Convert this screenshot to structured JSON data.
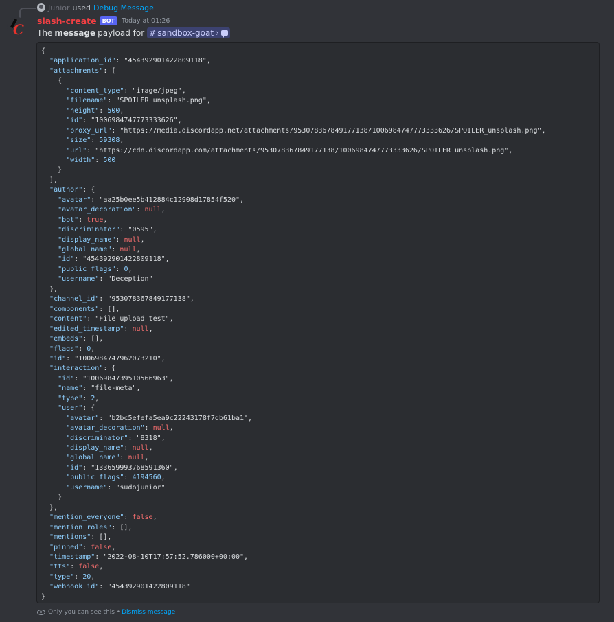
{
  "reply": {
    "user": "Junior",
    "used": "used",
    "command": "Debug Message"
  },
  "message": {
    "author": "slash-create",
    "badge": "BOT",
    "timestamp": "Today at 01:26",
    "intro_the": "The",
    "intro_bold": "message",
    "intro_rest": "payload for",
    "channel_hash": "#",
    "channel": "sandbox-goat",
    "channel_caret": "›"
  },
  "code": {
    "lines": [
      [
        [
          "p",
          "{"
        ]
      ],
      [
        [
          "p",
          "  "
        ],
        [
          "k",
          "\"application_id\""
        ],
        [
          "p",
          ": "
        ],
        [
          "s",
          "\"454392901422809118\""
        ],
        [
          "p",
          ","
        ]
      ],
      [
        [
          "p",
          "  "
        ],
        [
          "k",
          "\"attachments\""
        ],
        [
          "p",
          ": ["
        ]
      ],
      [
        [
          "p",
          "    {"
        ]
      ],
      [
        [
          "p",
          "      "
        ],
        [
          "k",
          "\"content_type\""
        ],
        [
          "p",
          ": "
        ],
        [
          "s",
          "\"image/jpeg\""
        ],
        [
          "p",
          ","
        ]
      ],
      [
        [
          "p",
          "      "
        ],
        [
          "k",
          "\"filename\""
        ],
        [
          "p",
          ": "
        ],
        [
          "s",
          "\"SPOILER_unsplash.png\""
        ],
        [
          "p",
          ","
        ]
      ],
      [
        [
          "p",
          "      "
        ],
        [
          "k",
          "\"height\""
        ],
        [
          "p",
          ": "
        ],
        [
          "n",
          "500"
        ],
        [
          "p",
          ","
        ]
      ],
      [
        [
          "p",
          "      "
        ],
        [
          "k",
          "\"id\""
        ],
        [
          "p",
          ": "
        ],
        [
          "s",
          "\"1006984747773333626\""
        ],
        [
          "p",
          ","
        ]
      ],
      [
        [
          "p",
          "      "
        ],
        [
          "k",
          "\"proxy_url\""
        ],
        [
          "p",
          ": "
        ],
        [
          "s",
          "\"https://media.discordapp.net/attachments/953078367849177138/1006984747773333626/SPOILER_unsplash.png\""
        ],
        [
          "p",
          ","
        ]
      ],
      [
        [
          "p",
          "      "
        ],
        [
          "k",
          "\"size\""
        ],
        [
          "p",
          ": "
        ],
        [
          "n",
          "59308"
        ],
        [
          "p",
          ","
        ]
      ],
      [
        [
          "p",
          "      "
        ],
        [
          "k",
          "\"url\""
        ],
        [
          "p",
          ": "
        ],
        [
          "s",
          "\"https://cdn.discordapp.com/attachments/953078367849177138/1006984747773333626/SPOILER_unsplash.png\""
        ],
        [
          "p",
          ","
        ]
      ],
      [
        [
          "p",
          "      "
        ],
        [
          "k",
          "\"width\""
        ],
        [
          "p",
          ": "
        ],
        [
          "n",
          "500"
        ]
      ],
      [
        [
          "p",
          "    }"
        ]
      ],
      [
        [
          "p",
          "  ],"
        ]
      ],
      [
        [
          "p",
          "  "
        ],
        [
          "k",
          "\"author\""
        ],
        [
          "p",
          ": {"
        ]
      ],
      [
        [
          "p",
          "    "
        ],
        [
          "k",
          "\"avatar\""
        ],
        [
          "p",
          ": "
        ],
        [
          "s",
          "\"aa25b0ee5b412884c12908d17854f520\""
        ],
        [
          "p",
          ","
        ]
      ],
      [
        [
          "p",
          "    "
        ],
        [
          "k",
          "\"avatar_decoration\""
        ],
        [
          "p",
          ": "
        ],
        [
          "lit",
          "null"
        ],
        [
          "p",
          ","
        ]
      ],
      [
        [
          "p",
          "    "
        ],
        [
          "k",
          "\"bot\""
        ],
        [
          "p",
          ": "
        ],
        [
          "lit",
          "true"
        ],
        [
          "p",
          ","
        ]
      ],
      [
        [
          "p",
          "    "
        ],
        [
          "k",
          "\"discriminator\""
        ],
        [
          "p",
          ": "
        ],
        [
          "s",
          "\"0595\""
        ],
        [
          "p",
          ","
        ]
      ],
      [
        [
          "p",
          "    "
        ],
        [
          "k",
          "\"display_name\""
        ],
        [
          "p",
          ": "
        ],
        [
          "lit",
          "null"
        ],
        [
          "p",
          ","
        ]
      ],
      [
        [
          "p",
          "    "
        ],
        [
          "k",
          "\"global_name\""
        ],
        [
          "p",
          ": "
        ],
        [
          "lit",
          "null"
        ],
        [
          "p",
          ","
        ]
      ],
      [
        [
          "p",
          "    "
        ],
        [
          "k",
          "\"id\""
        ],
        [
          "p",
          ": "
        ],
        [
          "s",
          "\"454392901422809118\""
        ],
        [
          "p",
          ","
        ]
      ],
      [
        [
          "p",
          "    "
        ],
        [
          "k",
          "\"public_flags\""
        ],
        [
          "p",
          ": "
        ],
        [
          "n",
          "0"
        ],
        [
          "p",
          ","
        ]
      ],
      [
        [
          "p",
          "    "
        ],
        [
          "k",
          "\"username\""
        ],
        [
          "p",
          ": "
        ],
        [
          "s",
          "\"Deception\""
        ]
      ],
      [
        [
          "p",
          "  },"
        ]
      ],
      [
        [
          "p",
          "  "
        ],
        [
          "k",
          "\"channel_id\""
        ],
        [
          "p",
          ": "
        ],
        [
          "s",
          "\"953078367849177138\""
        ],
        [
          "p",
          ","
        ]
      ],
      [
        [
          "p",
          "  "
        ],
        [
          "k",
          "\"components\""
        ],
        [
          "p",
          ": [],"
        ]
      ],
      [
        [
          "p",
          "  "
        ],
        [
          "k",
          "\"content\""
        ],
        [
          "p",
          ": "
        ],
        [
          "s",
          "\"File upload test\""
        ],
        [
          "p",
          ","
        ]
      ],
      [
        [
          "p",
          "  "
        ],
        [
          "k",
          "\"edited_timestamp\""
        ],
        [
          "p",
          ": "
        ],
        [
          "lit",
          "null"
        ],
        [
          "p",
          ","
        ]
      ],
      [
        [
          "p",
          "  "
        ],
        [
          "k",
          "\"embeds\""
        ],
        [
          "p",
          ": [],"
        ]
      ],
      [
        [
          "p",
          "  "
        ],
        [
          "k",
          "\"flags\""
        ],
        [
          "p",
          ": "
        ],
        [
          "n",
          "0"
        ],
        [
          "p",
          ","
        ]
      ],
      [
        [
          "p",
          "  "
        ],
        [
          "k",
          "\"id\""
        ],
        [
          "p",
          ": "
        ],
        [
          "s",
          "\"1006984747962073210\""
        ],
        [
          "p",
          ","
        ]
      ],
      [
        [
          "p",
          "  "
        ],
        [
          "k",
          "\"interaction\""
        ],
        [
          "p",
          ": {"
        ]
      ],
      [
        [
          "p",
          "    "
        ],
        [
          "k",
          "\"id\""
        ],
        [
          "p",
          ": "
        ],
        [
          "s",
          "\"1006984739510566963\""
        ],
        [
          "p",
          ","
        ]
      ],
      [
        [
          "p",
          "    "
        ],
        [
          "k",
          "\"name\""
        ],
        [
          "p",
          ": "
        ],
        [
          "s",
          "\"file-meta\""
        ],
        [
          "p",
          ","
        ]
      ],
      [
        [
          "p",
          "    "
        ],
        [
          "k",
          "\"type\""
        ],
        [
          "p",
          ": "
        ],
        [
          "n",
          "2"
        ],
        [
          "p",
          ","
        ]
      ],
      [
        [
          "p",
          "    "
        ],
        [
          "k",
          "\"user\""
        ],
        [
          "p",
          ": {"
        ]
      ],
      [
        [
          "p",
          "      "
        ],
        [
          "k",
          "\"avatar\""
        ],
        [
          "p",
          ": "
        ],
        [
          "s",
          "\"b2bc5efefa5ea9c22243178f7db61ba1\""
        ],
        [
          "p",
          ","
        ]
      ],
      [
        [
          "p",
          "      "
        ],
        [
          "k",
          "\"avatar_decoration\""
        ],
        [
          "p",
          ": "
        ],
        [
          "lit",
          "null"
        ],
        [
          "p",
          ","
        ]
      ],
      [
        [
          "p",
          "      "
        ],
        [
          "k",
          "\"discriminator\""
        ],
        [
          "p",
          ": "
        ],
        [
          "s",
          "\"8318\""
        ],
        [
          "p",
          ","
        ]
      ],
      [
        [
          "p",
          "      "
        ],
        [
          "k",
          "\"display_name\""
        ],
        [
          "p",
          ": "
        ],
        [
          "lit",
          "null"
        ],
        [
          "p",
          ","
        ]
      ],
      [
        [
          "p",
          "      "
        ],
        [
          "k",
          "\"global_name\""
        ],
        [
          "p",
          ": "
        ],
        [
          "lit",
          "null"
        ],
        [
          "p",
          ","
        ]
      ],
      [
        [
          "p",
          "      "
        ],
        [
          "k",
          "\"id\""
        ],
        [
          "p",
          ": "
        ],
        [
          "s",
          "\"133659993768591360\""
        ],
        [
          "p",
          ","
        ]
      ],
      [
        [
          "p",
          "      "
        ],
        [
          "k",
          "\"public_flags\""
        ],
        [
          "p",
          ": "
        ],
        [
          "n",
          "4194560"
        ],
        [
          "p",
          ","
        ]
      ],
      [
        [
          "p",
          "      "
        ],
        [
          "k",
          "\"username\""
        ],
        [
          "p",
          ": "
        ],
        [
          "s",
          "\"sudojunior\""
        ]
      ],
      [
        [
          "p",
          "    }"
        ]
      ],
      [
        [
          "p",
          "  },"
        ]
      ],
      [
        [
          "p",
          "  "
        ],
        [
          "k",
          "\"mention_everyone\""
        ],
        [
          "p",
          ": "
        ],
        [
          "lit",
          "false"
        ],
        [
          "p",
          ","
        ]
      ],
      [
        [
          "p",
          "  "
        ],
        [
          "k",
          "\"mention_roles\""
        ],
        [
          "p",
          ": [],"
        ]
      ],
      [
        [
          "p",
          "  "
        ],
        [
          "k",
          "\"mentions\""
        ],
        [
          "p",
          ": [],"
        ]
      ],
      [
        [
          "p",
          "  "
        ],
        [
          "k",
          "\"pinned\""
        ],
        [
          "p",
          ": "
        ],
        [
          "lit",
          "false"
        ],
        [
          "p",
          ","
        ]
      ],
      [
        [
          "p",
          "  "
        ],
        [
          "k",
          "\"timestamp\""
        ],
        [
          "p",
          ": "
        ],
        [
          "s",
          "\"2022-08-10T17:57:52.786000+00:00\""
        ],
        [
          "p",
          ","
        ]
      ],
      [
        [
          "p",
          "  "
        ],
        [
          "k",
          "\"tts\""
        ],
        [
          "p",
          ": "
        ],
        [
          "lit",
          "false"
        ],
        [
          "p",
          ","
        ]
      ],
      [
        [
          "p",
          "  "
        ],
        [
          "k",
          "\"type\""
        ],
        [
          "p",
          ": "
        ],
        [
          "n",
          "20"
        ],
        [
          "p",
          ","
        ]
      ],
      [
        [
          "p",
          "  "
        ],
        [
          "k",
          "\"webhook_id\""
        ],
        [
          "p",
          ": "
        ],
        [
          "s",
          "\"454392901422809118\""
        ]
      ],
      [
        [
          "p",
          "}"
        ]
      ]
    ]
  },
  "footer": {
    "notice": "Only you can see this •",
    "dismiss": "Dismiss message"
  },
  "colors": {
    "background": "#313338",
    "code_background": "#2b2d31",
    "key": "#8fd0ff",
    "literal": "#f56e6e",
    "author_name": "#f23f43",
    "bot_badge": "#5865f2",
    "link": "#00a8fc"
  },
  "icons": {
    "mini_avatar": "user-avatar-icon",
    "channel_bubble": "chat-bubble-icon",
    "eye": "eye-icon"
  }
}
